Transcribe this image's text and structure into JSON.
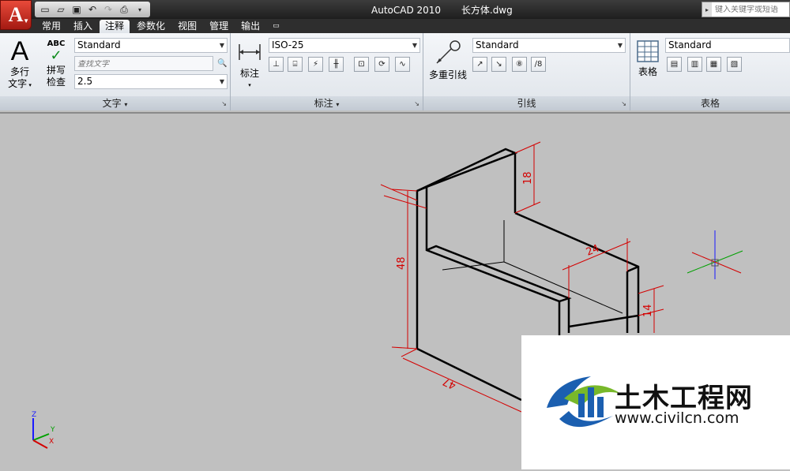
{
  "app": {
    "logo": "A",
    "title": "AutoCAD 2010",
    "filename": "长方体.dwg",
    "search_placeholder": "键入关键字或短语"
  },
  "qat": {
    "icons": [
      "new-icon",
      "open-icon",
      "save-icon",
      "undo-icon",
      "redo-icon",
      "plot-icon"
    ]
  },
  "tabs": [
    "常用",
    "插入",
    "注释",
    "参数化",
    "视图",
    "管理",
    "输出"
  ],
  "active_tab": "注释",
  "ribbon": {
    "text_panel": {
      "label": "文字",
      "multiline_label_1": "多行",
      "multiline_label_2": "文字",
      "spell_icon_text": "ABC",
      "spell_label_1": "拼写",
      "spell_label_2": "检查",
      "style_value": "Standard",
      "find_placeholder": "查找文字",
      "height_value": "2.5"
    },
    "dimension_panel": {
      "label": "标注",
      "dim_button_label": "标注",
      "style_value": "ISO-25"
    },
    "leader_panel": {
      "label": "引线",
      "multileader_label": "多重引线",
      "style_value": "Standard"
    },
    "table_panel": {
      "label": "表格",
      "table_label": "表格",
      "style_value": "Standard"
    }
  },
  "drawing": {
    "dimensions": [
      "18",
      "48",
      "24",
      "14",
      "47"
    ],
    "ucs_labels": [
      "Z",
      "Y",
      "X"
    ]
  },
  "watermark": {
    "title": "土木工程网",
    "url": "www.civilcn.com"
  },
  "colors": {
    "dimension": "#d40000",
    "model_edges": "#000000",
    "canvas_bg": "#c0c0c0"
  }
}
